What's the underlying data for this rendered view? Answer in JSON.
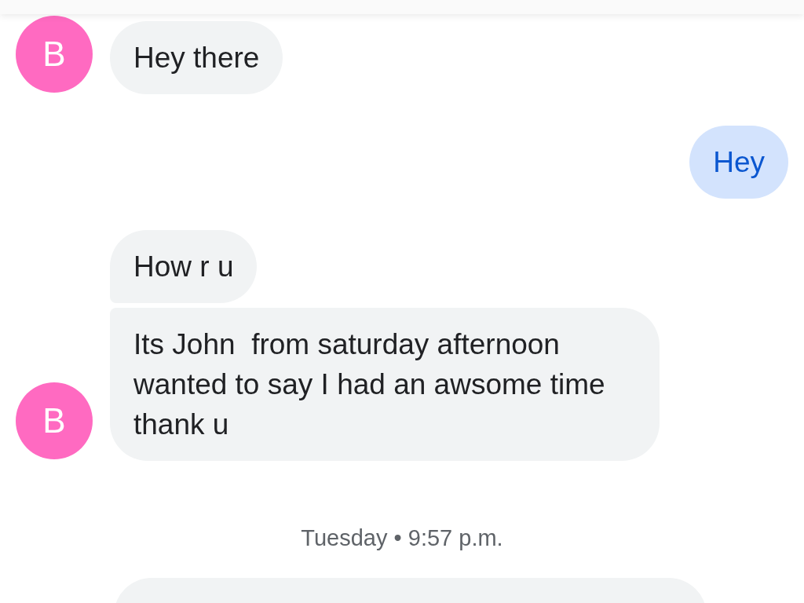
{
  "groups": [
    {
      "kind": "incoming",
      "avatar": "B",
      "color": "#ff6ac1",
      "bubbles": [
        "Hey there"
      ]
    },
    {
      "kind": "outgoing",
      "bubbles": [
        "Hey"
      ]
    },
    {
      "kind": "incoming",
      "avatar": "B",
      "color": "#ff6ac1",
      "bubbles": [
        "How r u",
        "Its John  from saturday afternoon wanted to say I had an awsome time thank u"
      ]
    }
  ],
  "timestamp": "Tuesday • 9:57 p.m.",
  "next_bubble_peek": true
}
